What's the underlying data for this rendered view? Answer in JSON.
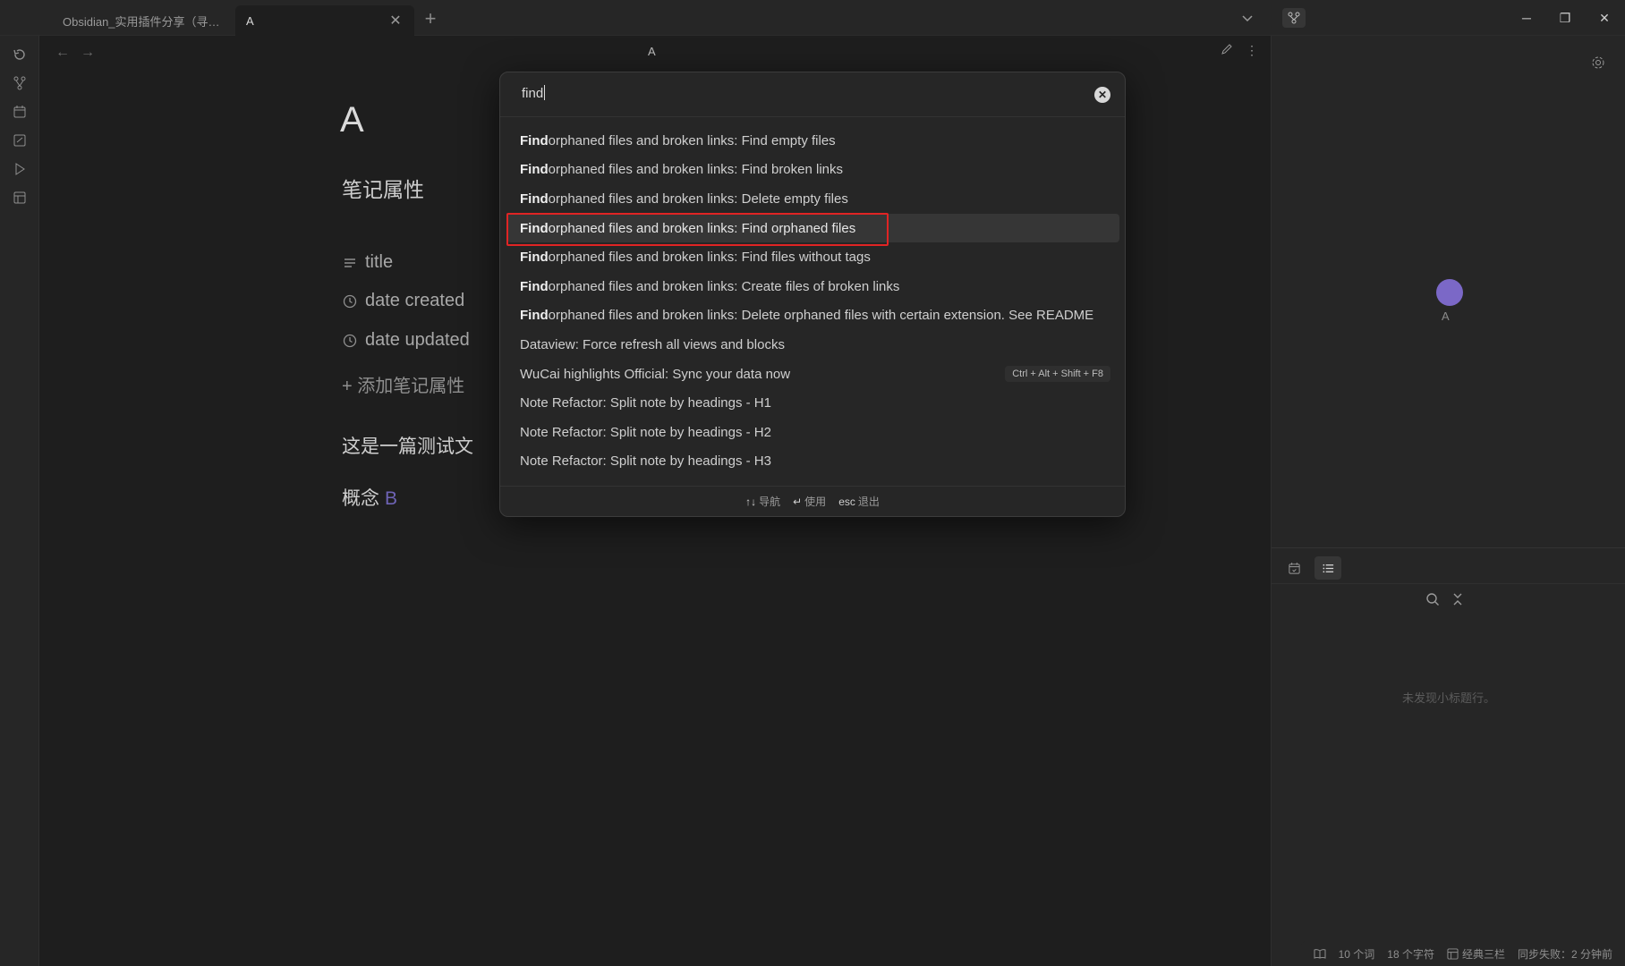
{
  "tabs": [
    {
      "label": "Obsidian_实用插件分享（寻找..."
    },
    {
      "label": "A"
    }
  ],
  "titlebar": {
    "new_tab": "+"
  },
  "editor": {
    "view_title": "A",
    "doc_title": "A",
    "properties_heading": "笔记属性",
    "properties": [
      {
        "name": "title",
        "icon": "text-lines-icon"
      },
      {
        "name": "date created",
        "icon": "clock-icon"
      },
      {
        "name": "date updated",
        "icon": "clock-icon"
      }
    ],
    "add_property": "+ 添加笔记属性",
    "body_text": "这是一篇测试文",
    "concept_label": "概念",
    "concept_link": "B"
  },
  "command_palette": {
    "query": "find",
    "results": [
      {
        "match": "Find",
        "rest": " orphaned files and broken links: Find empty files",
        "selected": false
      },
      {
        "match": "Find",
        "rest": " orphaned files and broken links: Find broken links",
        "selected": false
      },
      {
        "match": "Find",
        "rest": " orphaned files and broken links: Delete empty files",
        "selected": false
      },
      {
        "match": "Find",
        "rest": " orphaned files and broken links: Find orphaned files",
        "selected": true
      },
      {
        "match": "Find",
        "rest": " orphaned files and broken links: Find files without tags",
        "selected": false
      },
      {
        "match": "Find",
        "rest": " orphaned files and broken links: Create files of broken links",
        "selected": false
      },
      {
        "match": "Find",
        "rest": " orphaned files and broken links: Delete orphaned files with certain extension. See README",
        "selected": false
      }
    ],
    "other_results": [
      {
        "text": "Dataview: Force refresh all views and blocks",
        "hotkey": ""
      },
      {
        "text": "WuCai highlights Official: Sync your data now",
        "hotkey": "Ctrl + Alt + Shift + F8"
      },
      {
        "text": "Note Refactor: Split note by headings - H1",
        "hotkey": ""
      },
      {
        "text": "Note Refactor: Split note by headings - H2",
        "hotkey": ""
      },
      {
        "text": "Note Refactor: Split note by headings - H3",
        "hotkey": ""
      }
    ],
    "footer": {
      "nav_key": "↑↓",
      "nav_label": "导航",
      "use_key": "↵",
      "use_label": "使用",
      "esc_key": "esc",
      "esc_label": "退出"
    }
  },
  "right_sidebar": {
    "graph_node_label": "A",
    "outline_empty": "未发现小标题行。"
  },
  "statusbar": {
    "words": "10 个词",
    "chars": "18 个字符",
    "layout": "经典三栏",
    "sync": "同步失败：2 分钟前"
  },
  "colors": {
    "accent": "#7b68c7",
    "highlight_box": "#e02424",
    "link": "#6e63b5"
  }
}
